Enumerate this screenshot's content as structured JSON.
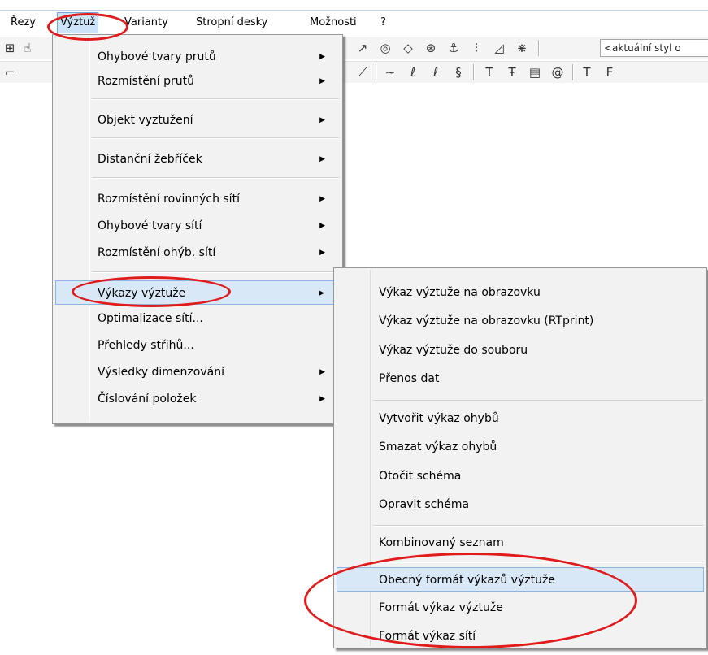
{
  "menubar": {
    "items": [
      "Řezy",
      "Výztuž",
      "Varianty",
      "Stropní desky",
      "Možnosti",
      "?"
    ]
  },
  "toolbar": {
    "style_box": "<aktuální styl o"
  },
  "menu_vyztuz": {
    "groups": [
      [
        {
          "label": "Ohybové tvary prutů",
          "submenu": true
        },
        {
          "label": "Rozmístění prutů",
          "submenu": true
        }
      ],
      [
        {
          "label": "Objekt vyztužení",
          "submenu": true
        }
      ],
      [
        {
          "label": "Distanční žebříček",
          "submenu": true
        }
      ],
      [
        {
          "label": "Rozmístění rovinných sítí",
          "submenu": true
        },
        {
          "label": "Ohybové tvary sítí",
          "submenu": true
        },
        {
          "label": "Rozmístění ohýb. sítí",
          "submenu": true
        }
      ],
      [
        {
          "label": "Výkazy výztuže",
          "submenu": true,
          "highlighted": true
        },
        {
          "label": "Optimalizace sítí...",
          "submenu": false
        },
        {
          "label": "Přehledy střihů...",
          "submenu": false
        },
        {
          "label": "Výsledky dimenzování",
          "submenu": true
        },
        {
          "label": "Číslování položek",
          "submenu": true
        }
      ]
    ]
  },
  "menu_vykazy": {
    "groups": [
      [
        {
          "label": "Výkaz výztuže na obrazovku"
        },
        {
          "label": "Výkaz výztuže na obrazovku (RTprint)"
        },
        {
          "label": "Výkaz výztuže do souboru"
        },
        {
          "label": "Přenos dat"
        }
      ],
      [
        {
          "label": "Vytvořit výkaz ohybů"
        },
        {
          "label": "Smazat výkaz ohybů"
        },
        {
          "label": "Otočit schéma"
        },
        {
          "label": "Opravit schéma"
        }
      ],
      [
        {
          "label": "Kombinovaný seznam"
        }
      ],
      [
        {
          "label": "Obecný formát výkazů výztuže",
          "highlighted": true
        },
        {
          "label": "Formát výkaz výztuže"
        },
        {
          "label": "Formát výkaz sítí"
        }
      ]
    ]
  },
  "colors": {
    "annotation": "#e01b1b",
    "highlight": "#d9e8f7"
  }
}
